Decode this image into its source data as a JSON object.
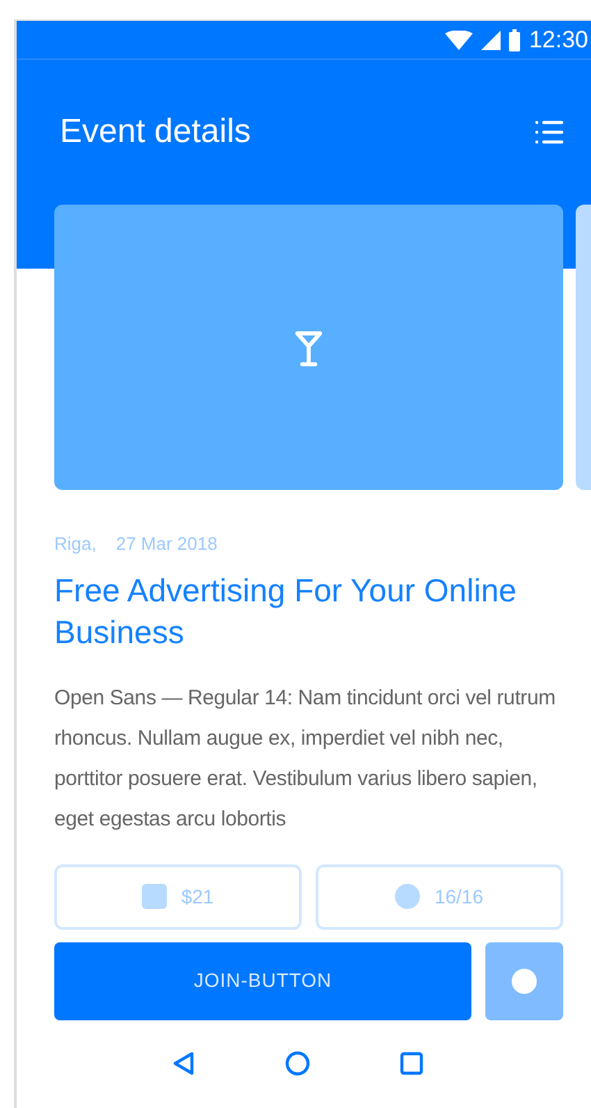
{
  "status_bar": {
    "time": "12:30"
  },
  "app_bar": {
    "title": "Event details"
  },
  "event": {
    "city": "Riga,",
    "date": "27 Mar 2018",
    "title": "Free Advertising For Your Online Business",
    "description": "Open Sans — Regular 14: Nam tincidunt orci vel rutrum rhoncus. Nullam augue ex, imperdiet vel nibh nec, porttitor posuere erat. Vestibulum varius libero sapien, eget egestas arcu lobortis"
  },
  "chips": [
    {
      "kind": "square",
      "label": "$21"
    },
    {
      "kind": "circle",
      "label": "16/16"
    }
  ],
  "actions": {
    "join_label": "JOIN-BUTTON"
  }
}
